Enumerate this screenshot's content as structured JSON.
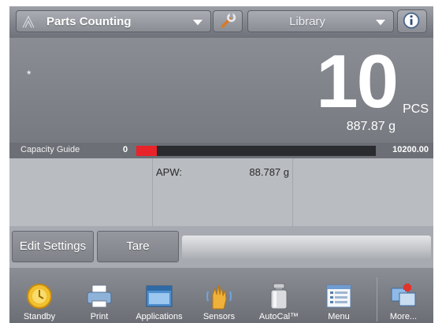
{
  "header": {
    "application": "Parts Counting",
    "library": "Library"
  },
  "display": {
    "stable_indicator": "*",
    "main_value": "10",
    "unit": "PCS",
    "secondary_value": "887.87 g"
  },
  "capacity_guide": {
    "label": "Capacity Guide",
    "min": "0",
    "max": "10200.00",
    "fill_fraction": 0.087,
    "fill_color": "#e8232a"
  },
  "info": {
    "apw_label": "APW:",
    "apw_value": "88.787 g"
  },
  "actions": {
    "edit_settings": "Edit Settings",
    "tare": "Tare"
  },
  "nav": [
    {
      "label": "Standby",
      "icon": "standby-icon"
    },
    {
      "label": "Print",
      "icon": "printer-icon"
    },
    {
      "label": "Applications",
      "icon": "applications-icon"
    },
    {
      "label": "Sensors",
      "icon": "sensor-hand-icon"
    },
    {
      "label": "AutoCal™",
      "icon": "weight-icon"
    },
    {
      "label": "Menu",
      "icon": "menu-list-icon"
    },
    {
      "label": "More...",
      "icon": "more-icon"
    }
  ]
}
